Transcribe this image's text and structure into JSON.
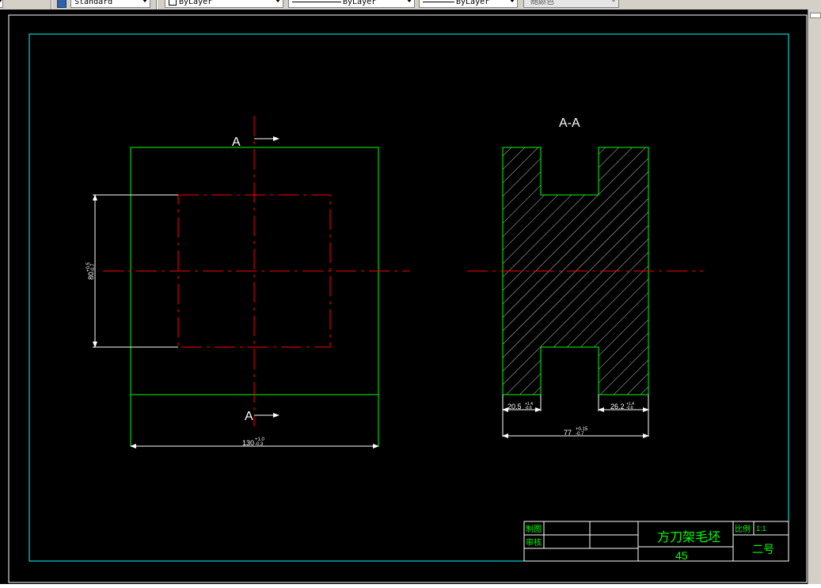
{
  "toolbar": {
    "text_style": "Standard",
    "color": "ByLayer",
    "linetype": "ByLayer",
    "lineweight": "ByLayer",
    "plot_style": "随颜色"
  },
  "colors": {
    "background": "#000000",
    "border": "#00ffff",
    "green": "#00ff00",
    "red": "#ff0000",
    "white": "#ffffff"
  },
  "drawing": {
    "section_label_top": "A",
    "section_label_bottom": "A",
    "section_title": "A-A",
    "dim_height": {
      "base": "80",
      "upper": "+0.5",
      "lower": "-0.7"
    },
    "dim_width": {
      "base": "130",
      "upper": "+1.0",
      "lower": "-0.3"
    },
    "dim_left_slot": {
      "base": "20.5",
      "upper": "+1.4",
      "lower": "-0.6"
    },
    "dim_right_slot": {
      "base": "26.2",
      "upper": "+1.4",
      "lower": "-0.6"
    },
    "dim_total": {
      "base": "77",
      "upper": "+0.15",
      "lower": "-0.7"
    }
  },
  "title_block": {
    "row1_label": "制图",
    "row2_label": "审核",
    "part_name": "方刀架毛坯",
    "material": "45",
    "scale_label": "比例",
    "scale_value": "1:1",
    "drawing_no": "二号"
  }
}
